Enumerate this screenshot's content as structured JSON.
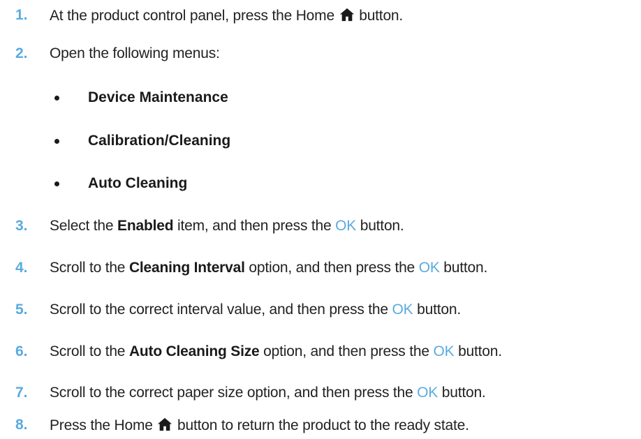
{
  "steps": [
    {
      "num": "1.",
      "pre": "At the product control panel, press the Home",
      "icon": "home-icon",
      "post": "button."
    },
    {
      "num": "2.",
      "pre": "Open the following menus:"
    },
    {
      "num": "3.",
      "pre": "Select the",
      "bold": "Enabled",
      "mid": "item, and then press the",
      "ok": "OK",
      "post": "button."
    },
    {
      "num": "4.",
      "pre": "Scroll to the",
      "bold": "Cleaning Interval",
      "mid": "option, and then press the",
      "ok": "OK",
      "post": "button."
    },
    {
      "num": "5.",
      "pre": "Scroll to the correct interval value, and then press the",
      "ok": "OK",
      "post": "button."
    },
    {
      "num": "6.",
      "pre": "Scroll to the",
      "bold": "Auto Cleaning Size",
      "mid": "option, and then press the",
      "ok": "OK",
      "post": "button."
    },
    {
      "num": "7.",
      "pre": "Scroll to the correct paper size option, and then press the",
      "ok": "OK",
      "post": "button."
    },
    {
      "num": "8.",
      "pre": "Press the Home",
      "icon": "home-icon",
      "post": "button to return the product to the ready state."
    }
  ],
  "menus": [
    "Device Maintenance",
    "Calibration/Cleaning",
    "Auto Cleaning"
  ],
  "colors": {
    "accent": "#5aabdf",
    "text": "#222222"
  }
}
